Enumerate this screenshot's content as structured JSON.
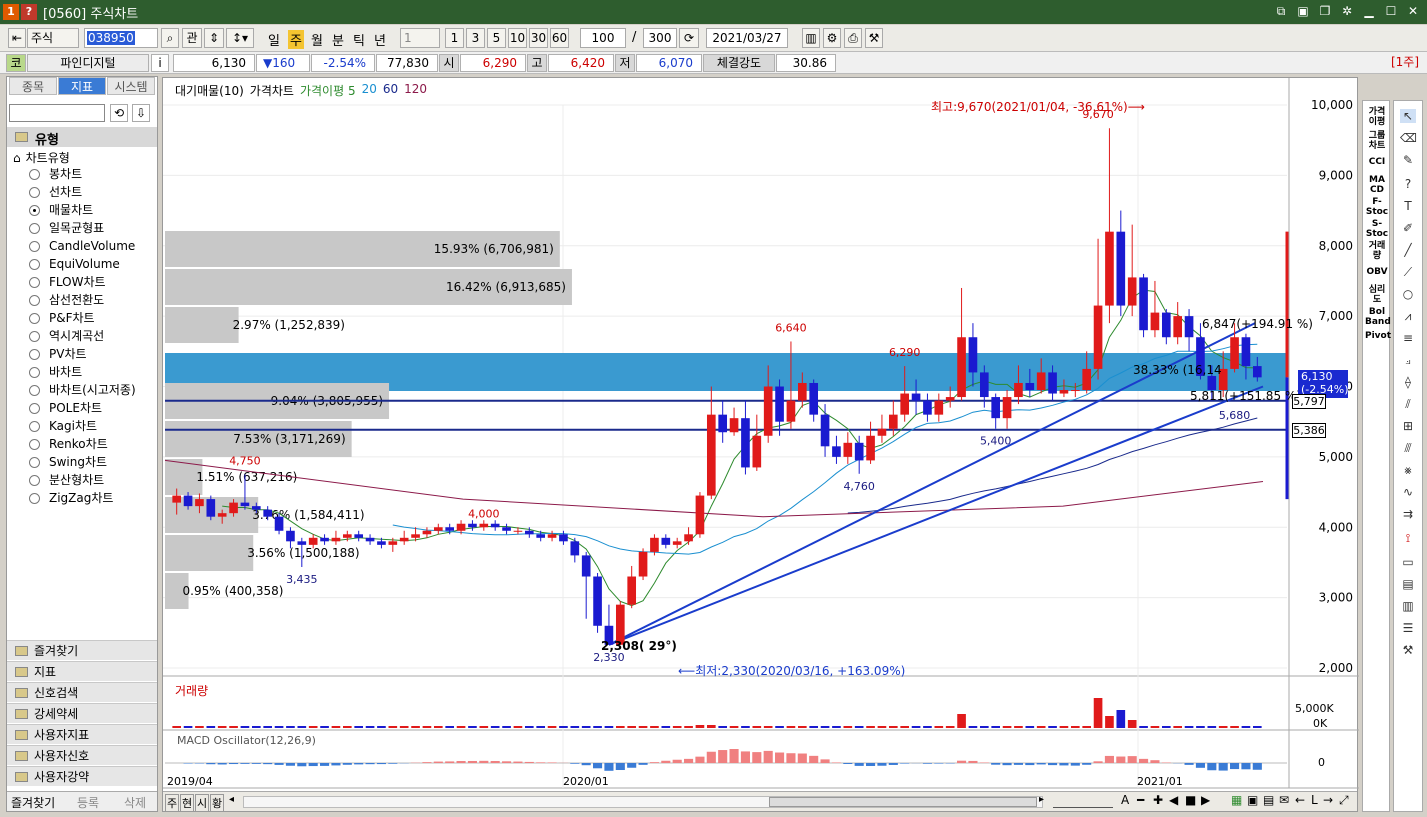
{
  "window": {
    "badge1": "1",
    "badge2": "?",
    "title": "[0560] 주식차트"
  },
  "toolbar": {
    "market": "주식",
    "code": "038950",
    "btn_gwan": "관",
    "periods": [
      "일",
      "주",
      "월",
      "분",
      "틱",
      "년"
    ],
    "active_period": "주",
    "interval_select": "1",
    "interval_buttons": [
      "1",
      "3",
      "5",
      "10",
      "30",
      "60"
    ],
    "count": "100",
    "slash": "/",
    "total": "300",
    "date": "2021/03/27"
  },
  "infobar": {
    "tag": "코",
    "name": "파인디지털",
    "info_icon": "i",
    "price": "6,130",
    "change": "▼160",
    "change_pct": "-2.54%",
    "volume": "77,830",
    "open_label": "시",
    "open": "6,290",
    "high_label": "고",
    "high": "6,420",
    "low_label": "저",
    "low": "6,070",
    "strength_label": "체결강도",
    "strength": "30.86",
    "period_badge": "[1주]"
  },
  "leftpanel": {
    "tabs": [
      "종목",
      "지표",
      "시스템"
    ],
    "active_tab": "지표",
    "section_title": "유형",
    "tree_root": "차트유형",
    "chart_types": [
      "봉차트",
      "선차트",
      "매물차트",
      "일목균형표",
      "CandleVolume",
      "EquiVolume",
      "FLOW차트",
      "삼선전환도",
      "P&F차트",
      "역시계곡선",
      "PV차트",
      "바차트",
      "바차트(시고저종)",
      "POLE차트",
      "Kagi차트",
      "Renko차트",
      "Swing차트",
      "분산형차트",
      "ZigZag차트"
    ],
    "selected_type": "매물차트",
    "bottom_sections": [
      "즐겨찾기",
      "지표",
      "신호검색",
      "강세약세",
      "사용자지표",
      "사용자신호",
      "사용자강약"
    ],
    "footer_tabs": [
      "즐겨찾기",
      "등록",
      "삭제"
    ]
  },
  "chart": {
    "legend": {
      "item1": "대기매물(10)",
      "item2": "가격차트",
      "item3": "가격이평 5",
      "item4": "20",
      "item5": "60",
      "item6": "120"
    },
    "annotations": {
      "high_note": "최고:9,670(2021/01/04, -36.61%)⟶",
      "low_note": "⟵최저:2,330(2020/03/16, +163.09%)",
      "angle_note": "2,308( 29°)",
      "trend1": "6,847(+194.91 %)",
      "trend2": "5,811(+151.85 %)",
      "big_band": "38.33% (16,14",
      "price_label": "6,130",
      "price_change_label": "(-2.54%)",
      "hline1": "5,797",
      "hline2": "5,386"
    },
    "peak_labels": [
      "9,670",
      "6,640",
      "6,290",
      "4,750",
      "4,000",
      "3,435",
      "4,760",
      "5,400",
      "5,680",
      "2,330"
    ],
    "xaxis": [
      "2019/04",
      "2020/01",
      "2021/01"
    ],
    "yaxis": [
      "10,000",
      "9,000",
      "8,000",
      "7,000",
      "6,000",
      "5,000",
      "4,000",
      "3,000",
      "2,000"
    ],
    "volume_title": "거래량",
    "volume_axis": [
      "5,000K",
      "0K"
    ],
    "macd_title": "MACD Oscillator(12,26,9)",
    "macd_axis": "0",
    "bottom_tabs": [
      "주",
      "현",
      "시",
      "황"
    ]
  },
  "chart_data": {
    "type": "candlestick",
    "title": "",
    "price_range": [
      2000,
      10000
    ],
    "volume_profile": [
      {
        "label": "15.93% (6,706,981)",
        "pct": 15.93
      },
      {
        "label": "16.42% (6,913,685)",
        "pct": 16.42
      },
      {
        "label": "2.97% (1,252,839)",
        "pct": 2.97
      },
      {
        "label": "38.33% (16,14",
        "pct": 38.33
      },
      {
        "label": "9.04% (3,805,955)",
        "pct": 9.04
      },
      {
        "label": "7.53% (3,171,269)",
        "pct": 7.53
      },
      {
        "label": "1.51% (637,216)",
        "pct": 1.51
      },
      {
        "label": "3.76% (1,584,411)",
        "pct": 3.76
      },
      {
        "label": "3.56% (1,500,188)",
        "pct": 3.56
      },
      {
        "label": "0.95% (400,358)",
        "pct": 0.95
      }
    ],
    "candles": [
      [
        4350,
        4450,
        4180,
        4550
      ],
      [
        4450,
        4300,
        4250,
        4500
      ],
      [
        4300,
        4400,
        4200,
        4480
      ],
      [
        4400,
        4150,
        4100,
        4450
      ],
      [
        4150,
        4200,
        4050,
        4250
      ],
      [
        4200,
        4350,
        4150,
        4400
      ],
      [
        4350,
        4300,
        4250,
        4750
      ],
      [
        4300,
        4250,
        4200,
        4350
      ],
      [
        4250,
        4150,
        4100,
        4300
      ],
      [
        4150,
        3950,
        3900,
        4200
      ],
      [
        3950,
        3800,
        3700,
        4000
      ],
      [
        3800,
        3750,
        3435,
        3850
      ],
      [
        3750,
        3850,
        3700,
        3900
      ],
      [
        3850,
        3800,
        3750,
        3900
      ],
      [
        3800,
        3850,
        3750,
        3950
      ],
      [
        3850,
        3900,
        3800,
        3950
      ],
      [
        3900,
        3850,
        3800,
        3950
      ],
      [
        3850,
        3800,
        3750,
        3900
      ],
      [
        3800,
        3750,
        3700,
        3850
      ],
      [
        3750,
        3800,
        3650,
        3850
      ],
      [
        3800,
        3850,
        3750,
        3950
      ],
      [
        3850,
        3900,
        3800,
        4000
      ],
      [
        3900,
        3950,
        3850,
        4000
      ],
      [
        3950,
        4000,
        3900,
        4050
      ],
      [
        4000,
        3950,
        3900,
        4050
      ],
      [
        3950,
        4050,
        3900,
        4100
      ],
      [
        4050,
        4000,
        3950,
        4100
      ],
      [
        4000,
        4050,
        3950,
        4100
      ],
      [
        4050,
        4000,
        3950,
        4100
      ],
      [
        4000,
        3950,
        3900,
        4050
      ],
      [
        3950,
        3950,
        3900,
        4000
      ],
      [
        3950,
        3900,
        3850,
        4000
      ],
      [
        3900,
        3850,
        3800,
        3950
      ],
      [
        3850,
        3900,
        3800,
        3950
      ],
      [
        3900,
        3800,
        3750,
        3950
      ],
      [
        3800,
        3600,
        3500,
        3850
      ],
      [
        3600,
        3300,
        2700,
        3650
      ],
      [
        3300,
        2600,
        2500,
        3350
      ],
      [
        2600,
        2330,
        2330,
        2900
      ],
      [
        2330,
        2900,
        2330,
        2950
      ],
      [
        2900,
        3300,
        2850,
        3450
      ],
      [
        3300,
        3650,
        3250,
        3700
      ],
      [
        3650,
        3850,
        3600,
        3900
      ],
      [
        3850,
        3750,
        3700,
        3900
      ],
      [
        3750,
        3800,
        3700,
        3850
      ],
      [
        3800,
        3900,
        3750,
        4000
      ],
      [
        3900,
        4450,
        3850,
        4500
      ],
      [
        4450,
        5600,
        4400,
        6000
      ],
      [
        5600,
        5350,
        5200,
        5800
      ],
      [
        5350,
        5550,
        5300,
        5700
      ],
      [
        5550,
        4850,
        4750,
        5800
      ],
      [
        4850,
        5300,
        4800,
        5600
      ],
      [
        5300,
        6000,
        5200,
        6300
      ],
      [
        6000,
        5500,
        5300,
        6100
      ],
      [
        5500,
        5800,
        5400,
        6640
      ],
      [
        5800,
        6050,
        5700,
        6200
      ],
      [
        6050,
        5600,
        5500,
        6100
      ],
      [
        5600,
        5150,
        5000,
        5750
      ],
      [
        5150,
        5000,
        4900,
        5300
      ],
      [
        5000,
        5200,
        4900,
        5350
      ],
      [
        5200,
        4950,
        4760,
        5300
      ],
      [
        4950,
        5300,
        4900,
        5500
      ],
      [
        5300,
        5400,
        5200,
        5600
      ],
      [
        5400,
        5600,
        5300,
        5800
      ],
      [
        5600,
        5900,
        5500,
        6290
      ],
      [
        5900,
        5800,
        5600,
        6100
      ],
      [
        5800,
        5600,
        5500,
        5900
      ],
      [
        5600,
        5800,
        5500,
        5900
      ],
      [
        5800,
        5850,
        5700,
        6000
      ],
      [
        5850,
        6700,
        5800,
        7400
      ],
      [
        6700,
        6200,
        6000,
        6900
      ],
      [
        6200,
        5850,
        5700,
        6300
      ],
      [
        5850,
        5550,
        5400,
        5900
      ],
      [
        5550,
        5850,
        5400,
        5950
      ],
      [
        5850,
        6050,
        5750,
        6300
      ],
      [
        6050,
        5950,
        5850,
        6250
      ],
      [
        5950,
        6200,
        5900,
        6400
      ],
      [
        6200,
        5900,
        5800,
        6300
      ],
      [
        5900,
        5950,
        5850,
        6100
      ],
      [
        5950,
        5950,
        5850,
        6050
      ],
      [
        5950,
        6250,
        5900,
        6500
      ],
      [
        6250,
        7150,
        6100,
        8100
      ],
      [
        7150,
        8200,
        6900,
        9670
      ],
      [
        8200,
        7150,
        7000,
        8500
      ],
      [
        7150,
        7550,
        7000,
        8300
      ],
      [
        7550,
        6800,
        6700,
        7600
      ],
      [
        6800,
        7050,
        6700,
        7500
      ],
      [
        7050,
        6700,
        6600,
        7100
      ],
      [
        6700,
        7000,
        6600,
        7200
      ],
      [
        7000,
        6700,
        6500,
        7100
      ],
      [
        6700,
        6150,
        6100,
        6900
      ],
      [
        6150,
        5950,
        5800,
        6300
      ],
      [
        5950,
        6250,
        5850,
        6500
      ],
      [
        6250,
        6700,
        6200,
        6900
      ],
      [
        6700,
        6290,
        6100,
        6750
      ],
      [
        6290,
        6130,
        6070,
        6420
      ]
    ]
  }
}
